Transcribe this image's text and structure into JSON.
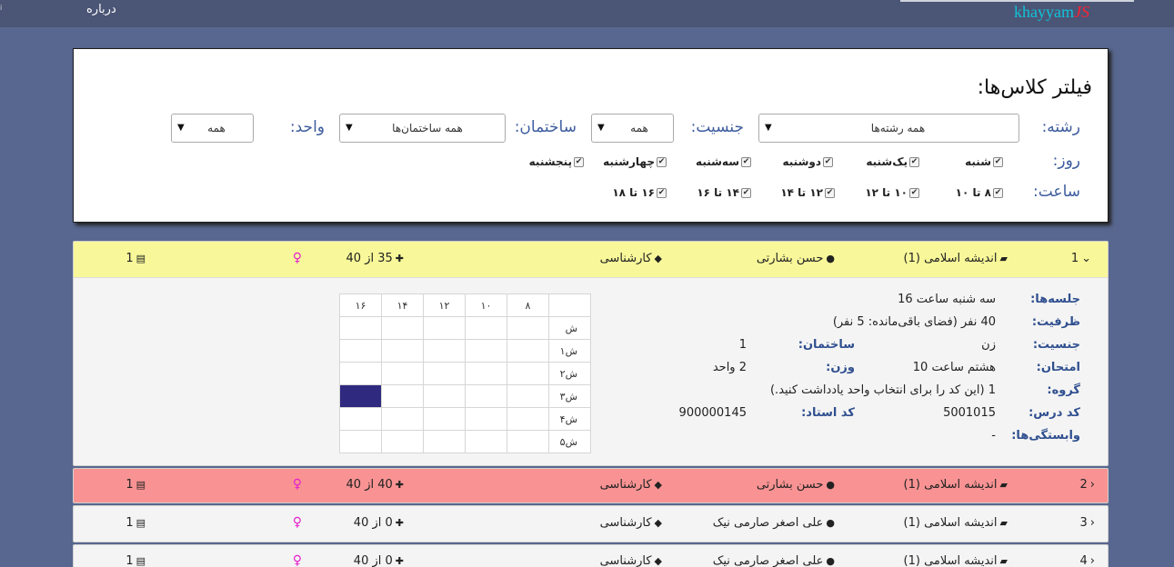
{
  "nav": {
    "brand_part1": "khayyam",
    "brand_part2": "JS",
    "about": "درباره",
    "tiny": "i"
  },
  "filter": {
    "title": "فیلتر کلاس‌ها:",
    "field_label": "رشته:",
    "field_value": "همه رشته‌ها",
    "gender_label": "جنسیت:",
    "gender_value": "همه",
    "building_label": "ساختمان:",
    "building_value": "همه ساختمان‌ها",
    "unit_label": "واحد:",
    "unit_value": "همه",
    "days_label": "روز:",
    "days": [
      "شنبه",
      "یک‌شنبه",
      "دوشنبه",
      "سه‌شنبه",
      "چهارشنبه",
      "پنجشنبه"
    ],
    "hours_label": "ساعت:",
    "hours": [
      "۸ تا ۱۰",
      "۱۰ تا ۱۲",
      "۱۲ تا ۱۴",
      "۱۴ تا ۱۶",
      "۱۶ تا ۱۸"
    ],
    "checkmark": "✔"
  },
  "rows": [
    {
      "num": "1",
      "course": "اندیشه اسلامی (1)",
      "teacher": "حسن بشارتی",
      "level": "کارشناسی",
      "capacity": "35 از 40",
      "units": "1"
    },
    {
      "num": "2",
      "course": "اندیشه اسلامی (1)",
      "teacher": "حسن بشارتی",
      "level": "کارشناسی",
      "capacity": "40 از 40",
      "units": "1"
    },
    {
      "num": "3",
      "course": "اندیشه اسلامی (1)",
      "teacher": "علی اصغر صارمی نیک",
      "level": "کارشناسی",
      "capacity": "0 از 40",
      "units": "1"
    },
    {
      "num": "4",
      "course": "اندیشه اسلامی (1)",
      "teacher": "علی اصغر صارمی نیک",
      "level": "کارشناسی",
      "capacity": "0 از 40",
      "units": "1"
    }
  ],
  "details": {
    "sessions_label": "جلسه‌ها:",
    "sessions_value": "سه شنبه ساعت 16",
    "capacity_label": "ظرفیت:",
    "capacity_value": "40 نفر (فضای باقی‌مانده: 5 نفر)",
    "gender_label": "جنسیت:",
    "gender_value": "زن",
    "building_label": "ساختمان:",
    "building_value": "1",
    "exam_label": "امتحان:",
    "exam_value": "هشتم ساعت 10",
    "weight_label": "وزن:",
    "weight_value": "2 واحد",
    "group_label": "گروه:",
    "group_value": "1 (این کد را برای انتخاب واحد یادداشت کنید.)",
    "code_label": "کد درس:",
    "code_value": "5001015",
    "teacher_code_label": "کد استاد:",
    "teacher_code_value": "900000145",
    "deps_label": "وابستگی‌ها:",
    "deps_value": "-"
  },
  "schedule": {
    "hours": [
      "۸",
      "۱۰",
      "۱۲",
      "۱۴",
      "۱۶"
    ],
    "days": [
      "ش",
      "۱ش",
      "۲ش",
      "۳ش",
      "۴ش",
      "۵ش"
    ],
    "filled": [
      {
        "day": "۳ش",
        "hour": "۱۶"
      }
    ],
    "fill_color": "#2f2a7f"
  },
  "colors": {
    "expanded_header": "#f8f89a",
    "full_row": "#f99393",
    "female_icon": "#e51fcf",
    "label_blue": "#3d5c9e"
  },
  "icons": [
    "check-square-icon",
    "chevron-down-icon",
    "chevron-left-icon",
    "book-icon",
    "user-icon",
    "graduation-cap-icon",
    "user-plus-icon",
    "female-icon",
    "building-icon",
    "caret-down-icon"
  ]
}
